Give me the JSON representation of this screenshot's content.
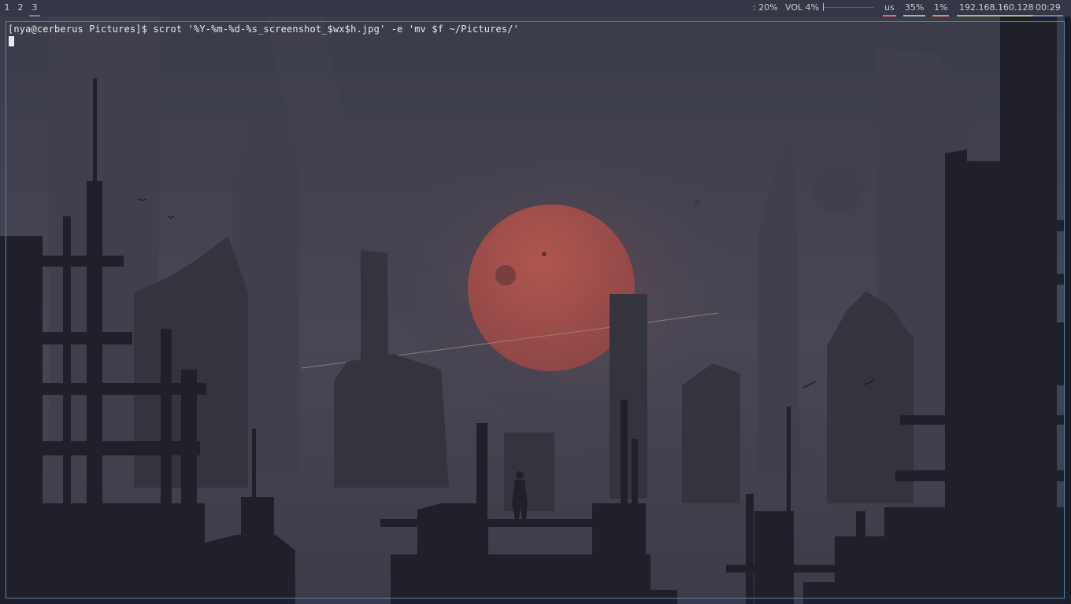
{
  "workspaces": [
    {
      "label": "1",
      "active": false
    },
    {
      "label": "2",
      "active": false
    },
    {
      "label": "3",
      "active": true
    }
  ],
  "status": {
    "brightness": ": 20%",
    "volume": "VOL 4%",
    "volume_level": 0.04,
    "keyboard": "us",
    "memory": "35%",
    "cpu": "1%",
    "ip": "192.168.160.128",
    "time": "00:29"
  },
  "colors": {
    "keyboard_underline": "#e06c75",
    "memory_underline": "#8fb8c8",
    "cpu_underline": "#e08870",
    "ip_underline": "#a3be8c",
    "time_underline": "#6d87b3",
    "terminal_border": "#4a86b8"
  },
  "terminal": {
    "prompt_line": "[nya@cerberus Pictures]$ scrot '%Y-%m-%d-%s_screenshot_$wx$h.jpg' -e 'mv $f ~/Pictures/'"
  }
}
